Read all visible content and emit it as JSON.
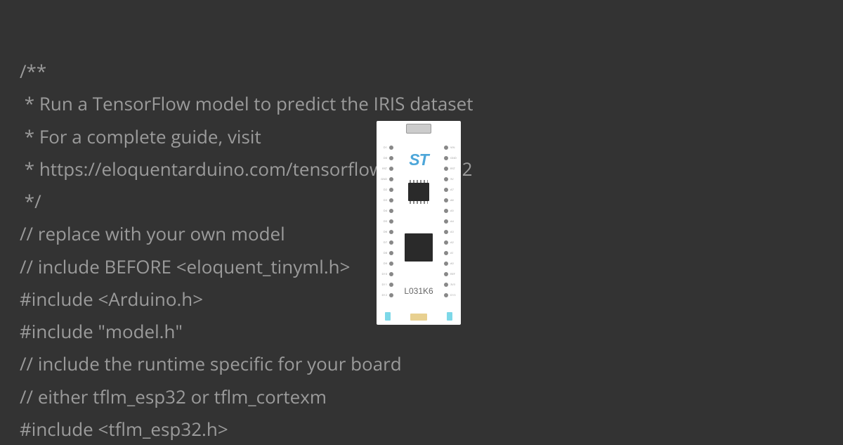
{
  "code": {
    "line1": "/**",
    "line2": " * Run a TensorFlow model to predict the IRIS dataset",
    "line3": " * For a complete guide, visit",
    "line4": " * https://eloquentarduino.com/tensorflow-lite-esp32",
    "line5": " */",
    "line6": "// replace with your own model",
    "line7": "// include BEFORE <eloquent_tinyml.h>",
    "line8": "#include <Arduino.h>",
    "line9": "#include \"model.h\"",
    "line10": "// include the runtime specific for your board",
    "line11": "// either tflm_esp32 or tflm_cortexm",
    "line12": "#include <tflm_esp32.h>"
  },
  "board": {
    "logo": "ST",
    "label": "L031K6"
  }
}
